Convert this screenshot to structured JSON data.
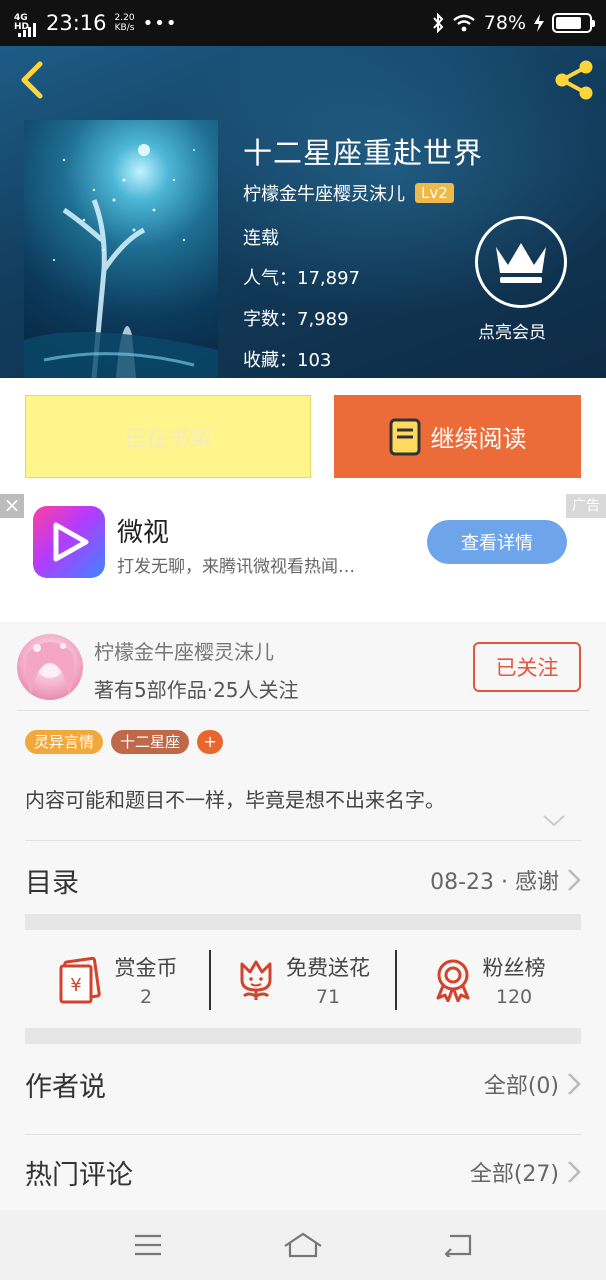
{
  "status_bar": {
    "network": "4G HD",
    "time": "23:16",
    "speed_value": "2.20",
    "speed_unit": "KB/s",
    "more": "•••",
    "battery_text": "78%",
    "battery_level": 0.78
  },
  "book": {
    "title": "十二星座重赴世界",
    "author": "柠檬金牛座樱灵沫儿",
    "level": "Lv2",
    "status": "连载",
    "popularity": "人气：17,897",
    "word_count": "字数：7,989",
    "favorites": "收藏：103",
    "vip_label": "点亮会员"
  },
  "actions": {
    "on_shelf": "已在书架",
    "continue_reading": "继续阅读"
  },
  "ad": {
    "close": "×",
    "tag": "广告",
    "app_name": "微视",
    "description": "打发无聊，来腾讯微视看热闻…",
    "cta": "查看详情"
  },
  "author_card": {
    "name": "柠檬金牛座樱灵沫儿",
    "stats": "著有5部作品·25人关注",
    "follow": "已关注"
  },
  "tags": {
    "items": [
      "灵异言情",
      "十二星座"
    ],
    "colors": [
      "#f2a93b",
      "#c0694a"
    ],
    "add": "+"
  },
  "synopsis": "内容可能和题目不一样，毕竟是想不出来名字。",
  "catalog": {
    "label": "目录",
    "latest": "08-23 · 感谢"
  },
  "stats": {
    "coins_label": "赏金币",
    "coins_value": "2",
    "flowers_label": "免费送花",
    "flowers_value": "71",
    "fans_label": "粉丝榜",
    "fans_value": "120"
  },
  "author_says": {
    "label": "作者说",
    "value": "全部(0)"
  },
  "comments": {
    "label": "热门评论",
    "value": "全部(27)"
  },
  "colors": {
    "accent_orange": "#ec6c39",
    "follow_red": "#e2573e",
    "icon_red": "#d2432c",
    "shelf_yellow": "#fff58b",
    "header_blue": "#123c5c",
    "icon_yellow": "#ffd53a"
  }
}
